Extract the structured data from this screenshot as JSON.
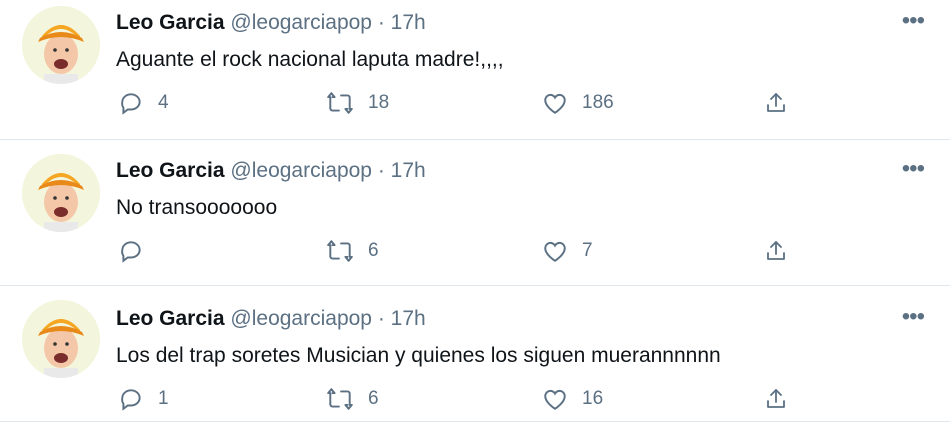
{
  "tweets": [
    {
      "author_name": "Leo Garcia",
      "handle": "@leogarciapop",
      "separator": "·",
      "time": "17h",
      "text": "Aguante el rock nacional laputa madre!,,,,",
      "replies": "4",
      "retweets": "18",
      "likes": "186"
    },
    {
      "author_name": "Leo Garcia",
      "handle": "@leogarciapop",
      "separator": "·",
      "time": "17h",
      "text": "No transooooooo",
      "replies": "",
      "retweets": "6",
      "likes": "7"
    },
    {
      "author_name": "Leo Garcia",
      "handle": "@leogarciapop",
      "separator": "·",
      "time": "17h",
      "text": "Los del trap soretes Musician y quienes los siguen muerannnnnn",
      "replies": "1",
      "retweets": "6",
      "likes": "16"
    }
  ],
  "icons": {
    "reply": "speech-bubble-icon",
    "retweet": "retweet-icon",
    "like": "heart-icon",
    "share": "share-icon",
    "more": "more-dots-icon"
  },
  "colors": {
    "text": "#0f1419",
    "secondary": "#5b7083",
    "divider": "#e1e8ed",
    "avatar_cap": "#f5a623"
  }
}
